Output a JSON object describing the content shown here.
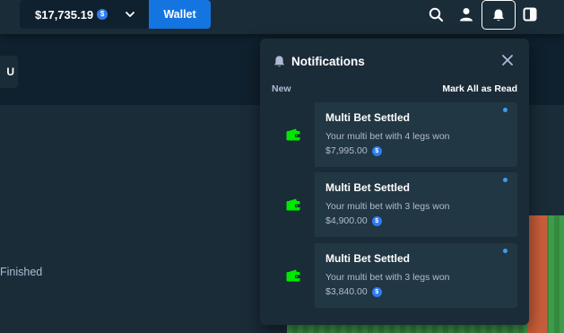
{
  "header": {
    "balance": "$17,735.19",
    "currency_icon": "coin-icon",
    "currency_symbol": "$",
    "wallet_label": "Wallet",
    "icons": [
      "search-icon",
      "user-icon",
      "bell-icon",
      "sidebar-toggle-icon"
    ]
  },
  "background": {
    "button_label": "U",
    "status_text": "Finished"
  },
  "notifications": {
    "title": "Notifications",
    "section_label": "New",
    "mark_all_label": "Mark All as Read",
    "items": [
      {
        "title": "Multi Bet Settled",
        "description": "Your multi bet with 4 legs won",
        "amount": "$7,995.00",
        "icon": "wallet-icon",
        "unread": true
      },
      {
        "title": "Multi Bet Settled",
        "description": "Your multi bet with 3 legs won",
        "amount": "$4,900.00",
        "icon": "wallet-icon",
        "unread": true
      },
      {
        "title": "Multi Bet Settled",
        "description": "Your multi bet with 3 legs won",
        "amount": "$3,840.00",
        "icon": "wallet-icon",
        "unread": true
      }
    ]
  },
  "colors": {
    "background": "#0f212e",
    "panel": "#1a2c38",
    "card": "#213743",
    "accent_blue": "#1475e1",
    "wallet_green": "#00e701",
    "muted_text": "#b1bad3",
    "unread_dot": "#3d9cf5"
  }
}
